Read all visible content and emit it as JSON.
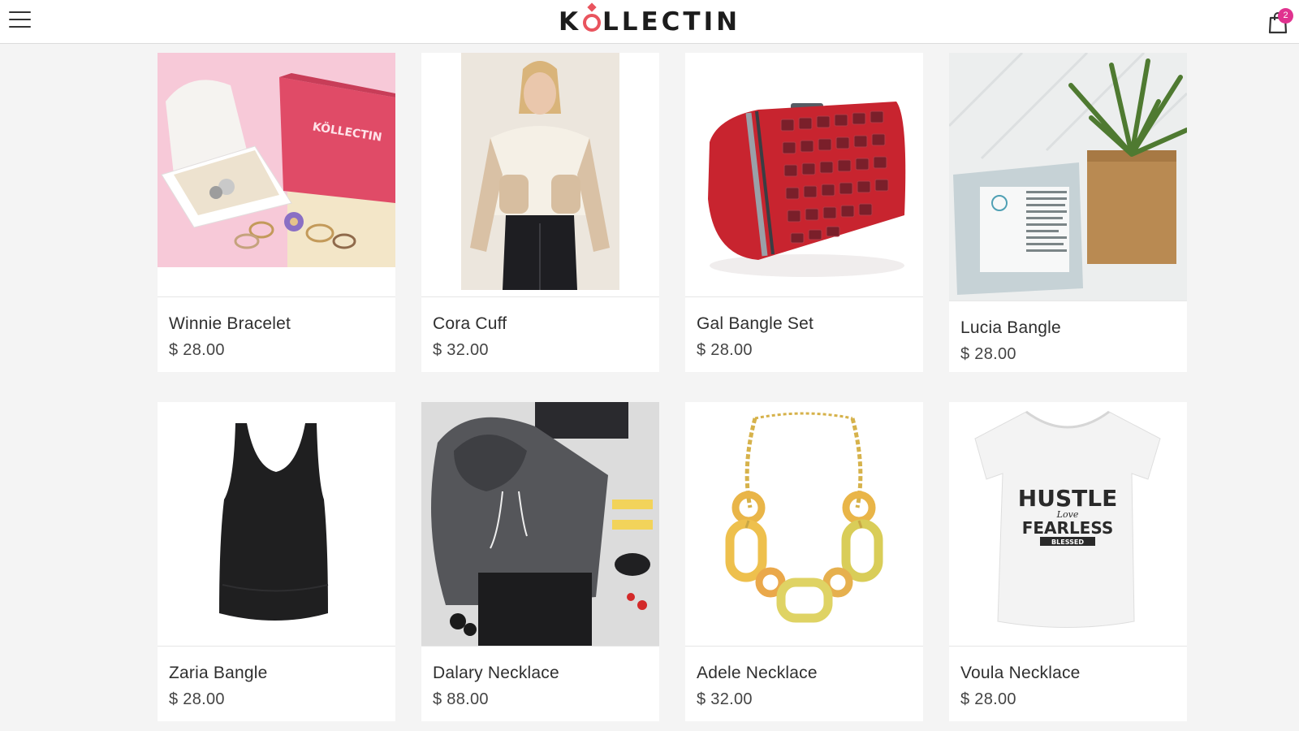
{
  "header": {
    "logo_pre": "K",
    "logo_post": "LLECTIN",
    "cart_count": "2"
  },
  "products": [
    {
      "name": "Winnie Bracelet",
      "price": "$ 28.00",
      "box_text": "KÖLLECTIN"
    },
    {
      "name": "Cora Cuff",
      "price": "$ 32.00"
    },
    {
      "name": "Gal Bangle Set",
      "price": "$ 28.00"
    },
    {
      "name": "Lucia Bangle",
      "price": "$ 28.00"
    },
    {
      "name": "Zaria Bangle",
      "price": "$ 28.00"
    },
    {
      "name": "Dalary Necklace",
      "price": "$ 88.00"
    },
    {
      "name": "Adele Necklace",
      "price": "$ 32.00"
    },
    {
      "name": "Voula Necklace",
      "price": "$ 28.00",
      "shirt_text": [
        "HUSTLE",
        "Love",
        "FEARLESS",
        "BLESSED"
      ]
    }
  ],
  "colors": {
    "accent": "#e9545e",
    "badge": "#e0328f",
    "background": "#f4f4f4"
  }
}
